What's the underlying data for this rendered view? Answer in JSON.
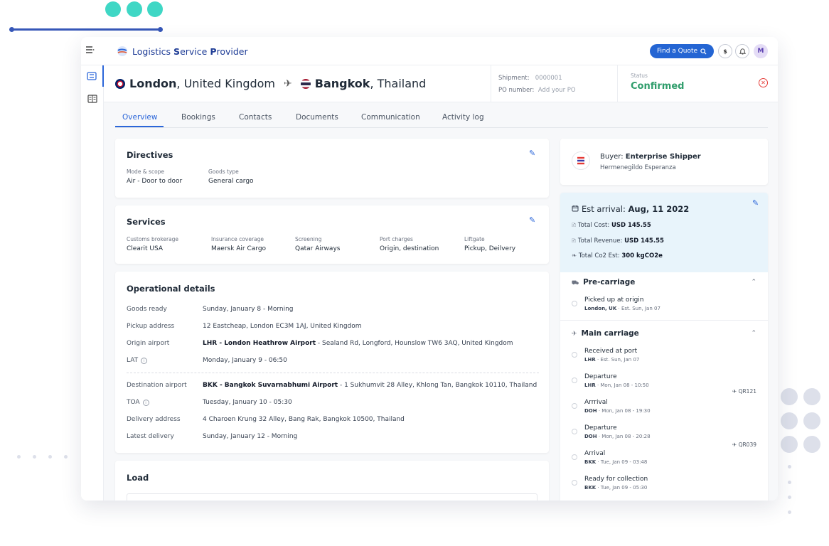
{
  "app": {
    "name_part1": "Logistics ",
    "name_part2": "S",
    "name_part3": "ervice ",
    "name_part4": "P",
    "name_part5": "rovider"
  },
  "topbar": {
    "quote_label": "Find a Quote",
    "currency_label": "$",
    "bell_label": "🔔",
    "avatar_initial": "M"
  },
  "route": {
    "origin_city": "London",
    "origin_country": ", United Kingdom",
    "dest_city": "Bangkok",
    "dest_country": ", Thailand"
  },
  "shipment": {
    "shipment_label": "Shipment:",
    "shipment_value": "0000001",
    "po_label": "PO number:",
    "po_placeholder": "Add your PO"
  },
  "status": {
    "label": "Status",
    "value": "Confirmed"
  },
  "tabs": [
    "Overview",
    "Bookings",
    "Contacts",
    "Documents",
    "Communication",
    "Activity log"
  ],
  "directives": {
    "title": "Directives",
    "mode_label": "Mode & scope",
    "mode_value": "Air - Door to door",
    "goods_label": "Goods type",
    "goods_value": "General cargo"
  },
  "services": {
    "title": "Services",
    "items": [
      {
        "label": "Customs brokerage",
        "value": "Clearit USA"
      },
      {
        "label": "Insurance coverage",
        "value": "Maersk Air Cargo"
      },
      {
        "label": "Screening",
        "value": "Qatar Airways"
      },
      {
        "label": "Port charges",
        "value": "Origin, destination"
      },
      {
        "label": "Liftgate",
        "value": "Pickup, Deilvery"
      }
    ]
  },
  "operational": {
    "title": "Operational details",
    "goods_ready_label": "Goods ready",
    "goods_ready_value": "Sunday, January 8 - Morning",
    "pickup_label": "Pickup address",
    "pickup_value": "12 Eastcheap, London EC3M 1AJ, United Kingdom",
    "origin_label": "Origin airport",
    "origin_bold": "LHR - London Heathrow Airport",
    "origin_rest": " -  Sealand Rd, Longford, Hounslow TW6 3AQ, United Kingdom",
    "lat_label": "LAT",
    "lat_value": "Monday, January 9 - 06:50",
    "dest_label": "Destination  airport",
    "dest_bold": "BKK - Bangkok Suvarnabhumi Airport",
    "dest_rest": " - 1 Sukhumvit 28 Alley, Khlong Tan, Bangkok 10110, Thailand",
    "toa_label": "TOA",
    "toa_value": "Tuesday,  January 10 - 05:30",
    "delivery_label": "Delivery address",
    "delivery_value": "4 Charoen Krung 32 Alley, Bang Rak, Bangkok 10500, Thailand",
    "latest_label": "Latest delivery",
    "latest_value": "Sunday, January 12 - Morning"
  },
  "load": {
    "title": "Load"
  },
  "buyer": {
    "label": "Buyer: ",
    "name": "Enterprise Shipper",
    "contact": "Hermenegildo Esperanza"
  },
  "arrival": {
    "title_label": "Est arrival: ",
    "title_value": "Aug, 11 2022",
    "cost_label": "Total Cost: ",
    "cost_value": "USD 145.55",
    "revenue_label": "Total Revenue:  ",
    "revenue_value": "USD 145.55",
    "co2_label": "Total Co2 Est: ",
    "co2_value": "300 kgCO2e"
  },
  "precarriage": {
    "title": "Pre-carriage",
    "events": [
      {
        "title": "Picked up at origin",
        "loc": "London, UK",
        "time": " · Est. Sun, Jan 07"
      }
    ]
  },
  "maincarriage": {
    "title": "Main carriage",
    "events": [
      {
        "title": "Received at port",
        "loc": "LHR",
        "time": " · Est. Sun, Jan 07"
      },
      {
        "title": "Departure",
        "loc": "LHR",
        "time": " · Mon, Jan 08 - 10:50"
      },
      {
        "title": "Arrrival",
        "loc": "DOH",
        "time": " · Mon, Jan 08 - 19:30"
      },
      {
        "title": "Departure",
        "loc": "DOH",
        "time": " · Mon, Jan 08 - 20:28"
      },
      {
        "title": "Arrival",
        "loc": "BKK",
        "time": " · Tue, Jan 09 - 03:48"
      },
      {
        "title": "Ready for collection",
        "loc": "BKK",
        "time": " · Tue, Jan 09 - 05:30"
      }
    ],
    "flight1": "QR121",
    "flight2": "QR039"
  },
  "colors": {
    "accent": "#2b66d9",
    "brand": "#1e3c96",
    "status_ok": "#2f9d6b",
    "teal_decor": "#3fd7c5"
  },
  "icons": [
    "menu-icon",
    "route-icon",
    "grid-icon",
    "search-icon",
    "dollar-icon",
    "bell-icon",
    "plane-icon",
    "close-circle-icon",
    "edit-icon",
    "info-icon",
    "calendar-icon",
    "receipt-icon",
    "leaf-icon",
    "truck-icon",
    "chevron-up-icon"
  ]
}
